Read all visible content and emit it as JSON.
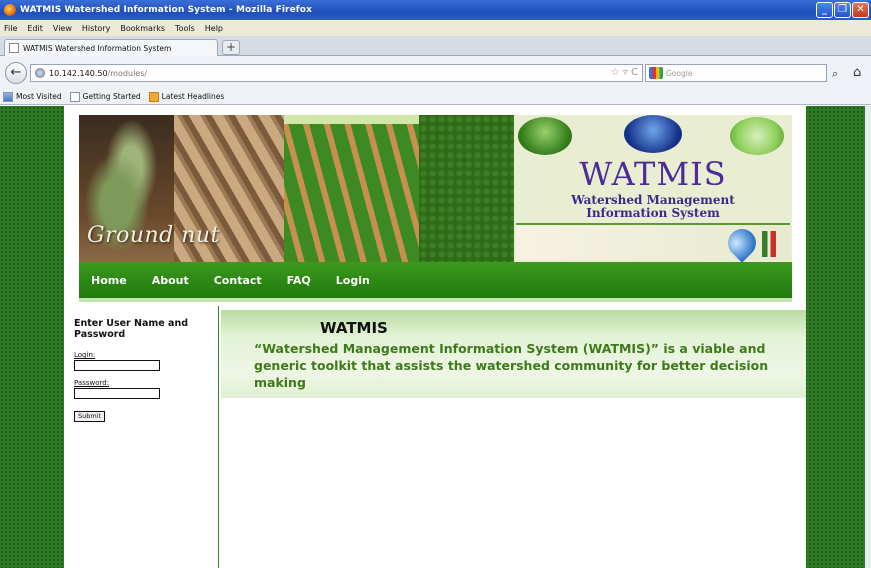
{
  "window": {
    "title": "WATMIS Watershed Information System - Mozilla Firefox",
    "controls": [
      "_",
      "❐",
      "✕"
    ]
  },
  "menu": [
    "File",
    "Edit",
    "View",
    "History",
    "Bookmarks",
    "Tools",
    "Help"
  ],
  "tab": {
    "label": "WATMIS Watershed Information System",
    "new_tab": "+"
  },
  "address": {
    "host": "10.142.140.50",
    "path": "/modules/",
    "back": "←",
    "tools": "☆ ▿ C"
  },
  "search": {
    "placeholder": "Google",
    "go": "⌕",
    "home": "⌂"
  },
  "bookmarks": [
    "Most Visited",
    "Getting Started",
    "Latest Headlines"
  ],
  "banner": {
    "caption": "Ground nut",
    "logo_title": "WATMIS",
    "logo_sub1": "Watershed Management",
    "logo_sub2": "Information System",
    "strip_plants": "⺌ ⺌ ⺌ ⺌ ⺌ ⺌ ⺌"
  },
  "nav": [
    "Home",
    "About",
    "Contact",
    "FAQ",
    "Login"
  ],
  "login": {
    "heading": "Enter User Name and Password",
    "login_label": "Login:",
    "password_label": "Password:",
    "submit": "Submit"
  },
  "main": {
    "title": "WATMIS",
    "description": "“Watershed Management Information System (WATMIS)” is a viable and generic toolkit that assists the watershed community for better decision making"
  },
  "colors": {
    "nav_green": "#2c8714",
    "text_green": "#3e7a1a",
    "logo_purple": "#4a2c9a",
    "page_bg": "#2f7a24"
  }
}
